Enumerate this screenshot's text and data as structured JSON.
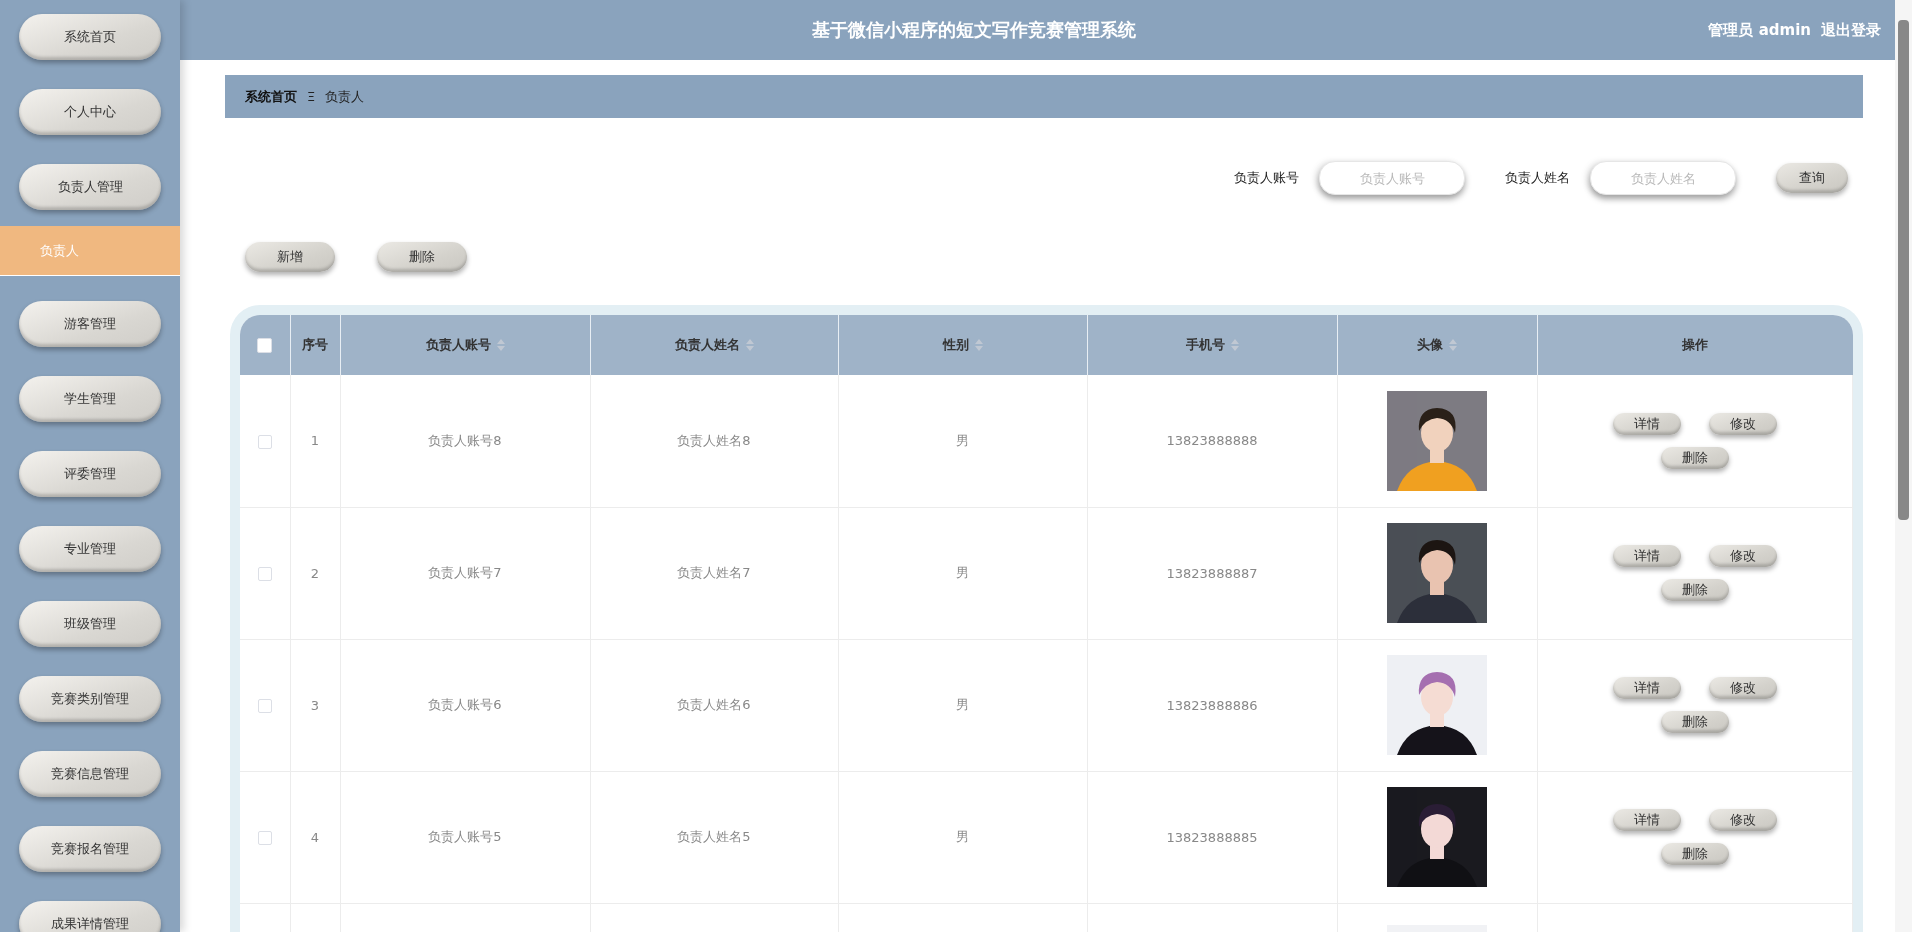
{
  "sidebar": {
    "items": [
      {
        "label": "系统首页",
        "kind": "button",
        "selected": false
      },
      {
        "label": "个人中心",
        "kind": "button",
        "selected": false
      },
      {
        "label": "负责人管理",
        "kind": "button",
        "selected": false
      },
      {
        "label": "负责人",
        "kind": "subitem",
        "selected": true
      },
      {
        "label": "游客管理",
        "kind": "button",
        "selected": false
      },
      {
        "label": "学生管理",
        "kind": "button",
        "selected": false
      },
      {
        "label": "评委管理",
        "kind": "button",
        "selected": false
      },
      {
        "label": "专业管理",
        "kind": "button",
        "selected": false
      },
      {
        "label": "班级管理",
        "kind": "button",
        "selected": false
      },
      {
        "label": "竞赛类别管理",
        "kind": "button",
        "selected": false
      },
      {
        "label": "竞赛信息管理",
        "kind": "button",
        "selected": false
      },
      {
        "label": "竞赛报名管理",
        "kind": "button",
        "selected": false
      },
      {
        "label": "成果详情管理",
        "kind": "button",
        "selected": false
      }
    ]
  },
  "header": {
    "title": "基于微信小程序的短文写作竞赛管理系统",
    "user": "管理员 admin",
    "logout": "退出登录"
  },
  "breadcrumb": {
    "home": "系统首页",
    "separator": "Ξ",
    "current": "负责人"
  },
  "search": {
    "fields": [
      {
        "label": "负责人账号",
        "placeholder": "负责人账号"
      },
      {
        "label": "负责人姓名",
        "placeholder": "负责人姓名"
      }
    ],
    "button": "查询"
  },
  "actions": [
    "新增",
    "删除"
  ],
  "table": {
    "select_all": {
      "checked": false
    },
    "columns": [
      {
        "label": "序号",
        "sortable": false
      },
      {
        "label": "负责人账号",
        "sortable": true
      },
      {
        "label": "负责人姓名",
        "sortable": true
      },
      {
        "label": "性别",
        "sortable": true
      },
      {
        "label": "手机号",
        "sortable": true
      },
      {
        "label": "头像",
        "sortable": true
      },
      {
        "label": "操作",
        "sortable": false
      }
    ],
    "rows": [
      {
        "checked": false,
        "index": "1",
        "account": "负责人账号8",
        "name": "负责人姓名8",
        "gender": "男",
        "phone": "13823888888",
        "avatar": {
          "kind": "picture"
        },
        "buttons": [
          "详情",
          "修改",
          "删除"
        ]
      },
      {
        "checked": false,
        "index": "2",
        "account": "负责人账号7",
        "name": "负责人姓名7",
        "gender": "男",
        "phone": "13823888887",
        "avatar": {
          "kind": "picture"
        },
        "buttons": [
          "详情",
          "修改",
          "删除"
        ]
      },
      {
        "checked": false,
        "index": "3",
        "account": "负责人账号6",
        "name": "负责人姓名6",
        "gender": "男",
        "phone": "13823888886",
        "avatar": {
          "kind": "picture"
        },
        "buttons": [
          "详情",
          "修改",
          "删除"
        ]
      },
      {
        "checked": false,
        "index": "4",
        "account": "负责人账号5",
        "name": "负责人姓名5",
        "gender": "男",
        "phone": "13823888885",
        "avatar": {
          "kind": "picture"
        },
        "buttons": [
          "详情",
          "修改",
          "删除"
        ]
      },
      {
        "avatar": {
          "kind": "picture"
        }
      }
    ]
  }
}
